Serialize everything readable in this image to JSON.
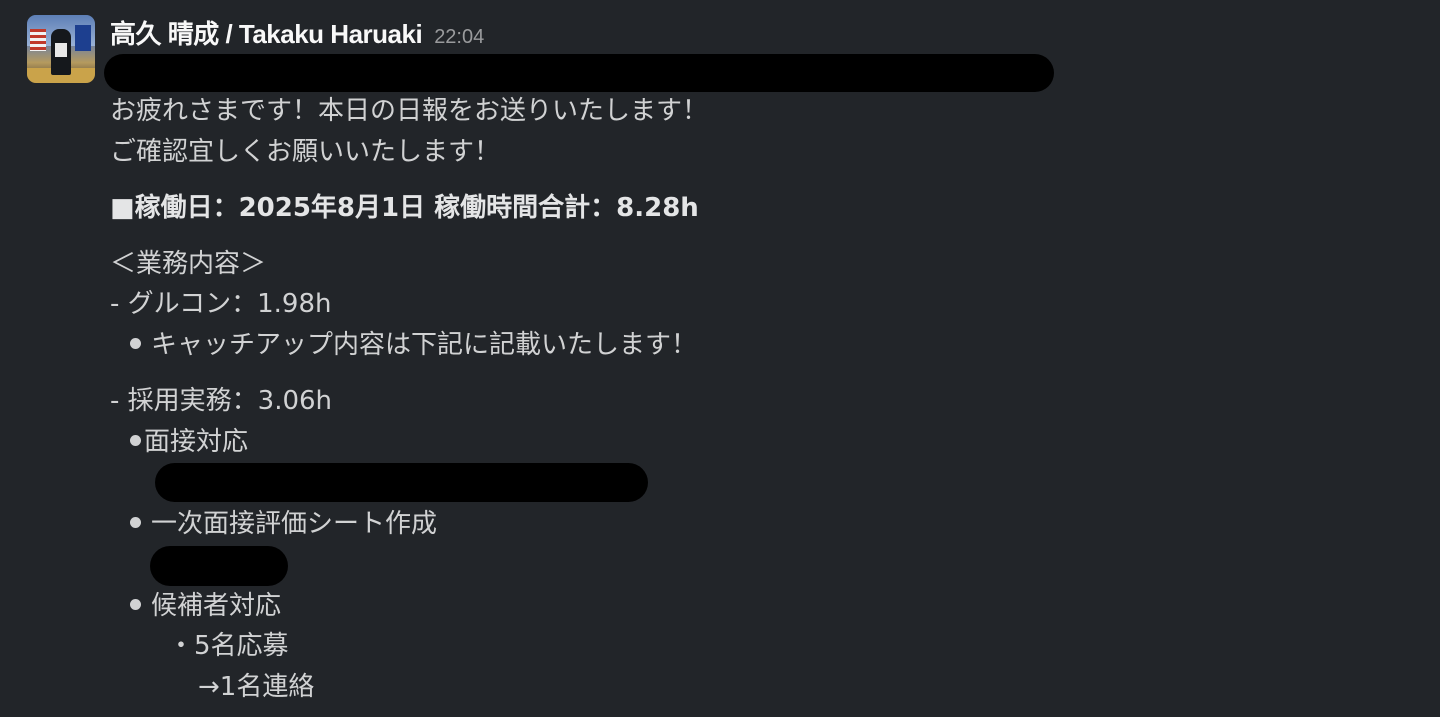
{
  "message": {
    "sender": "高久 晴成 / Takaku Haruaki",
    "timestamp": "22:04",
    "avatar_icon": "user-avatar-photo"
  },
  "body": {
    "greeting_1": "お疲れさまです！本日の日報をお送りいたします！",
    "greeting_2": "ご確認宜しくお願いいたします！",
    "work_summary": "■稼働日：2025年8月1日 稼働時間合計：8.28h",
    "section_heading": "＜業務内容＞",
    "task_1_title": "- グルコン：1.98h",
    "task_1_bullet": "キャッチアップ内容は下記に記載いたします！",
    "task_2_title": "- 採用実務：3.06h",
    "task_2_bullet_1": "面接対応",
    "task_2_bullet_2": "一次面接評価シート作成",
    "task_2_bullet_3": "候補者対応",
    "task_2_sub_1": "・5名応募",
    "task_2_sub_2": "→1名連絡"
  },
  "colors": {
    "background": "#222529",
    "text": "#d1d2d3",
    "sender": "#f8f8f8",
    "timestamp": "#9a9b9d",
    "redaction": "#000000"
  }
}
